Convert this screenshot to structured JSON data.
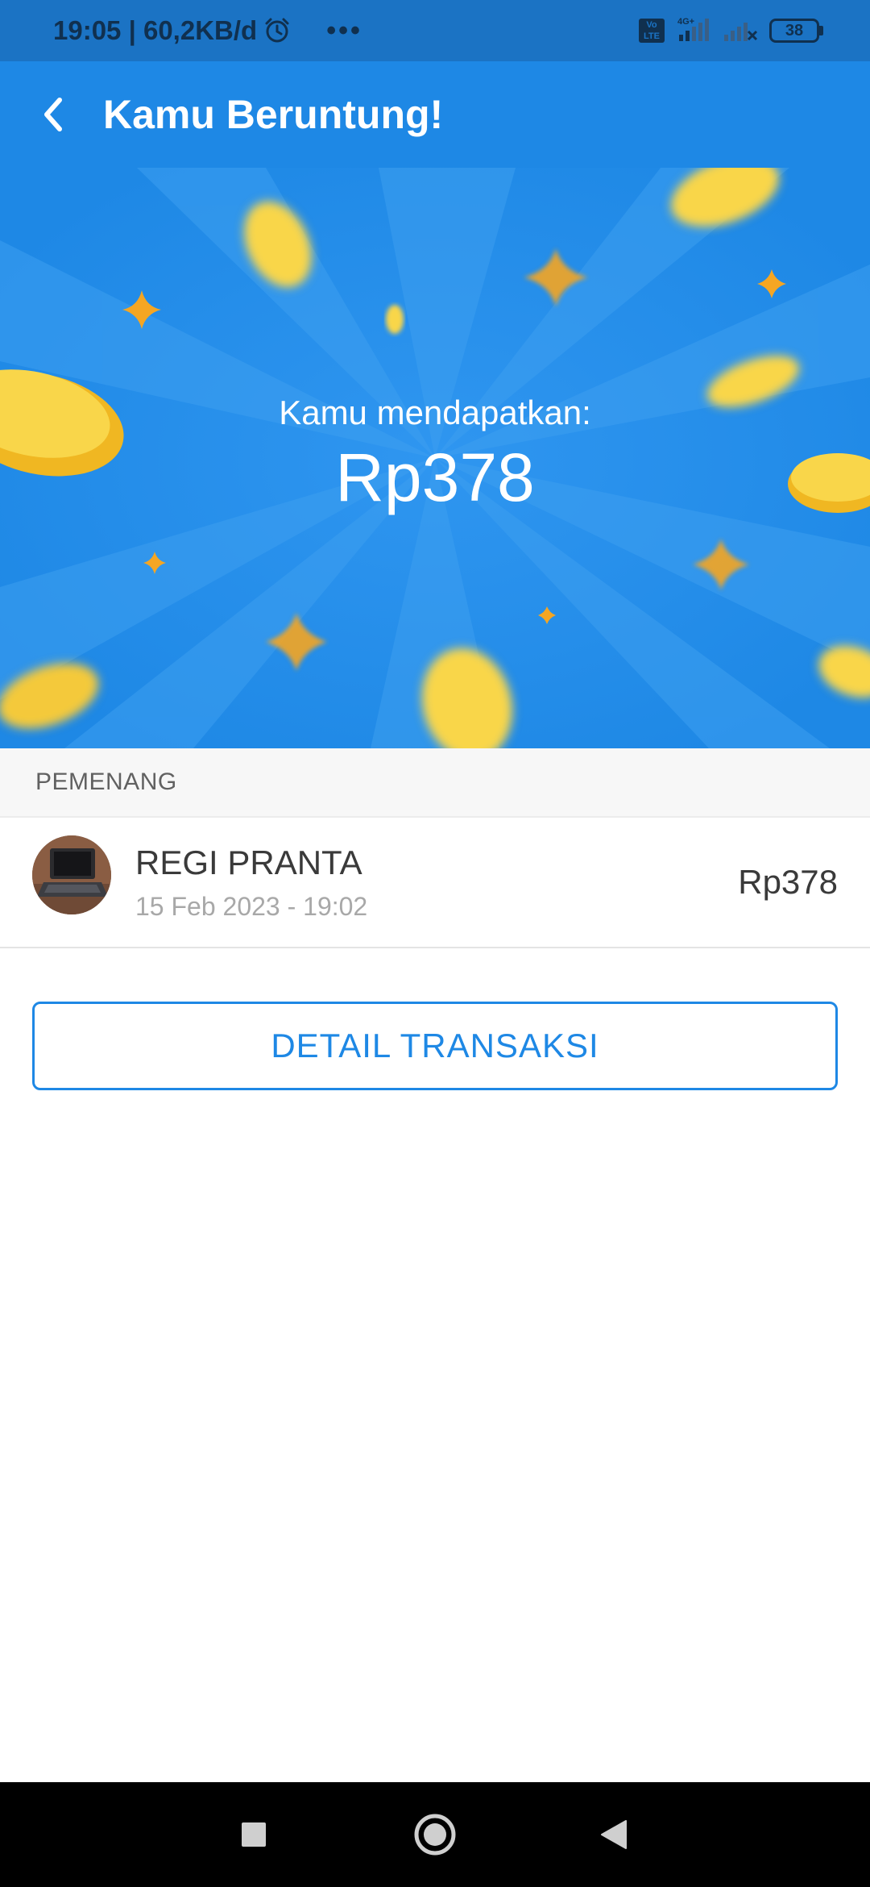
{
  "status_bar": {
    "time_speed": "19:05 | 60,2KB/d",
    "dots": "•••",
    "volte": "Vo LTE",
    "network": "4G+",
    "battery": "38"
  },
  "app_bar": {
    "title": "Kamu Beruntung!",
    "back_icon": "chevron-left-icon"
  },
  "hero": {
    "label": "Kamu mendapatkan:",
    "amount": "Rp378",
    "colors": {
      "background": "#1e88e5",
      "coin": "#f9d23c",
      "sparkle": "#f5a623"
    }
  },
  "winners": {
    "header": "PEMENANG",
    "items": [
      {
        "name": "REGI PRANTA",
        "date": "15 Feb 2023 - 19:02",
        "amount": "Rp378"
      }
    ]
  },
  "detail_button": {
    "label": "DETAIL TRANSAKSI"
  },
  "nav_bar": {
    "recents_icon": "square-icon",
    "home_icon": "circle-icon",
    "back_icon": "triangle-back-icon"
  }
}
